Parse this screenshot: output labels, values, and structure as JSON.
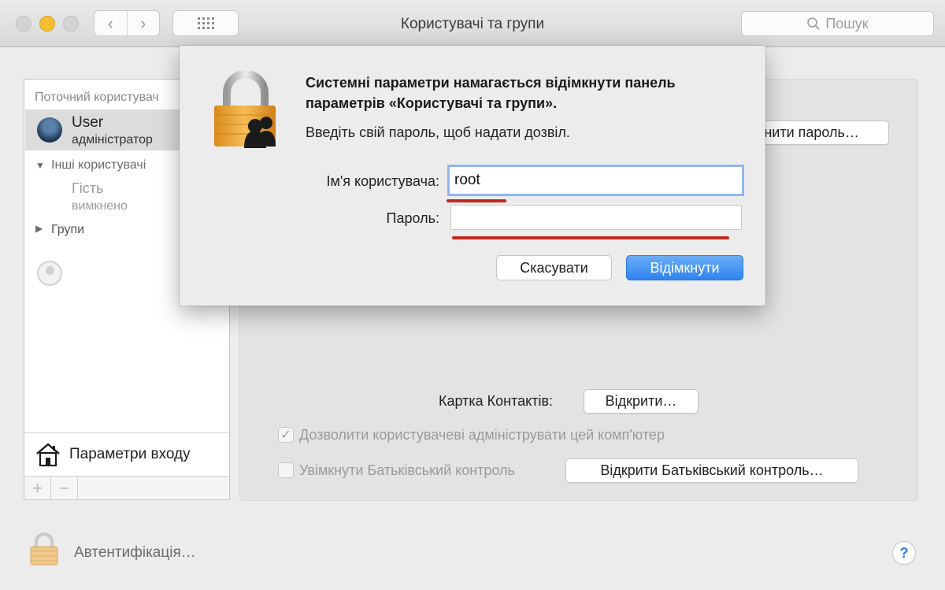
{
  "window": {
    "title": "Користувачі та групи"
  },
  "toolbar": {
    "back_icon": "chevron-left-icon",
    "forward_icon": "chevron-right-icon",
    "grid_icon": "show-all-grid-icon",
    "search_placeholder": "Пошук"
  },
  "sidebar": {
    "current_section": "Поточний користувач",
    "current_user": {
      "name": "User",
      "role": "адміністратор"
    },
    "other_section": "Інші користувачі",
    "guest": {
      "name": "Гість",
      "status": "вимкнено"
    },
    "groups": "Групи",
    "login_options": "Параметри входу",
    "add_label": "+",
    "remove_label": "−"
  },
  "panel": {
    "change_password": "Змінити пароль…",
    "contacts_label": "Картка Контактів:",
    "open_button": "Відкрити…",
    "allow_admin": {
      "label": "Дозволити користувачеві адмініструвати цей комп'ютер",
      "checked": true,
      "check_glyph": "✓"
    },
    "parental": {
      "label": "Увімкнути Батьківський контроль",
      "checked": false
    },
    "open_parental": "Відкрити Батьківський контроль…"
  },
  "footer": {
    "auth_label": "Автентифікація…",
    "help_label": "?"
  },
  "dialog": {
    "title": "Системні параметри намагається відімкнути панель параметрів «Користувачі та групи».",
    "message": "Введіть свій пароль, щоб надати дозвіл.",
    "username_label": "Ім'я користувача:",
    "username_value": "root",
    "password_label": "Пароль:",
    "password_value": "",
    "cancel": "Скасувати",
    "unlock": "Відімкнути"
  },
  "colors": {
    "accent": "#2f83ef",
    "annotation_red": "#c0281e",
    "lock_gold": "#e6a23c"
  }
}
